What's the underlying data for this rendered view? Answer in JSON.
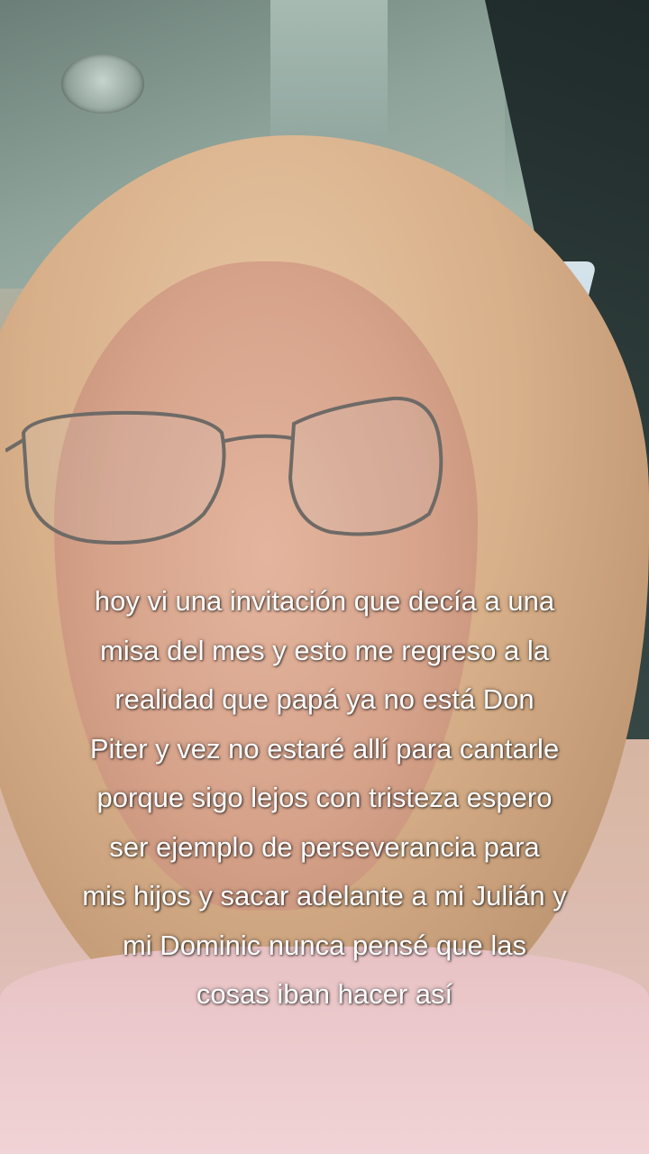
{
  "caption": {
    "lines": [
      "hoy vi una invitación que decía a una",
      "misa del mes y esto me regreso a la",
      "realidad que papá ya no está Don",
      "Piter y vez no estaré allí para cantarle",
      "porque sigo lejos con tristeza  espero",
      "ser ejemplo de perseverancia para",
      "mis hijos y sacar adelante a mi Julián y",
      "mi Dominic nunca pensé que las",
      "cosas iban hacer así"
    ],
    "color": "#ffffff"
  }
}
